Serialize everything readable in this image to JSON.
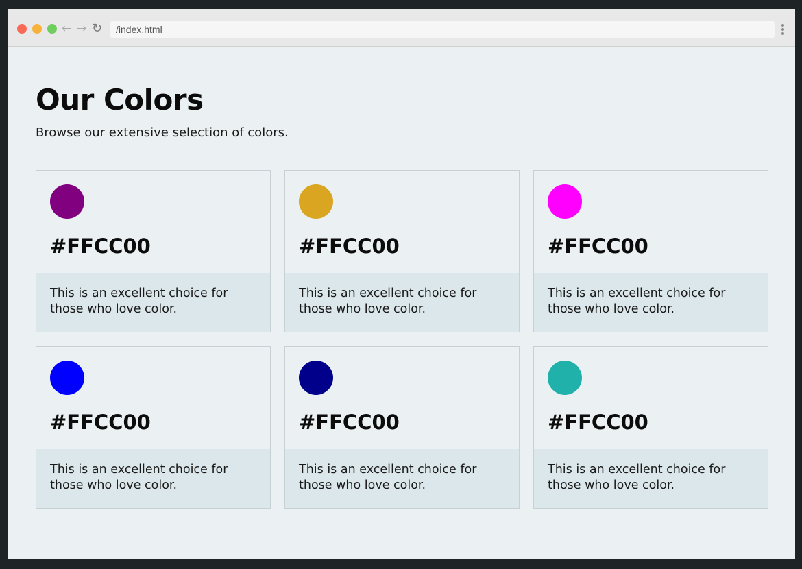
{
  "browser": {
    "url": "/index.html",
    "back_icon": "arrow-left-icon",
    "forward_icon": "arrow-right-icon",
    "reload_icon": "reload-icon"
  },
  "page": {
    "title": "Our Colors",
    "subtitle": "Browse our extensive selection of colors."
  },
  "cards": [
    {
      "swatch_color": "#800080",
      "title": "#FFCC00",
      "description": "This is an excellent choice for those who love color."
    },
    {
      "swatch_color": "#DAA520",
      "title": "#FFCC00",
      "description": "This is an excellent choice for those who love color."
    },
    {
      "swatch_color": "#FF00FF",
      "title": "#FFCC00",
      "description": "This is an excellent choice for those who love color."
    },
    {
      "swatch_color": "#0000FF",
      "title": "#FFCC00",
      "description": "This is an excellent choice for those who love color."
    },
    {
      "swatch_color": "#00008B",
      "title": "#FFCC00",
      "description": "This is an excellent choice for those who love color."
    },
    {
      "swatch_color": "#20B2AA",
      "title": "#FFCC00",
      "description": "This is an excellent choice for those who love color."
    }
  ]
}
